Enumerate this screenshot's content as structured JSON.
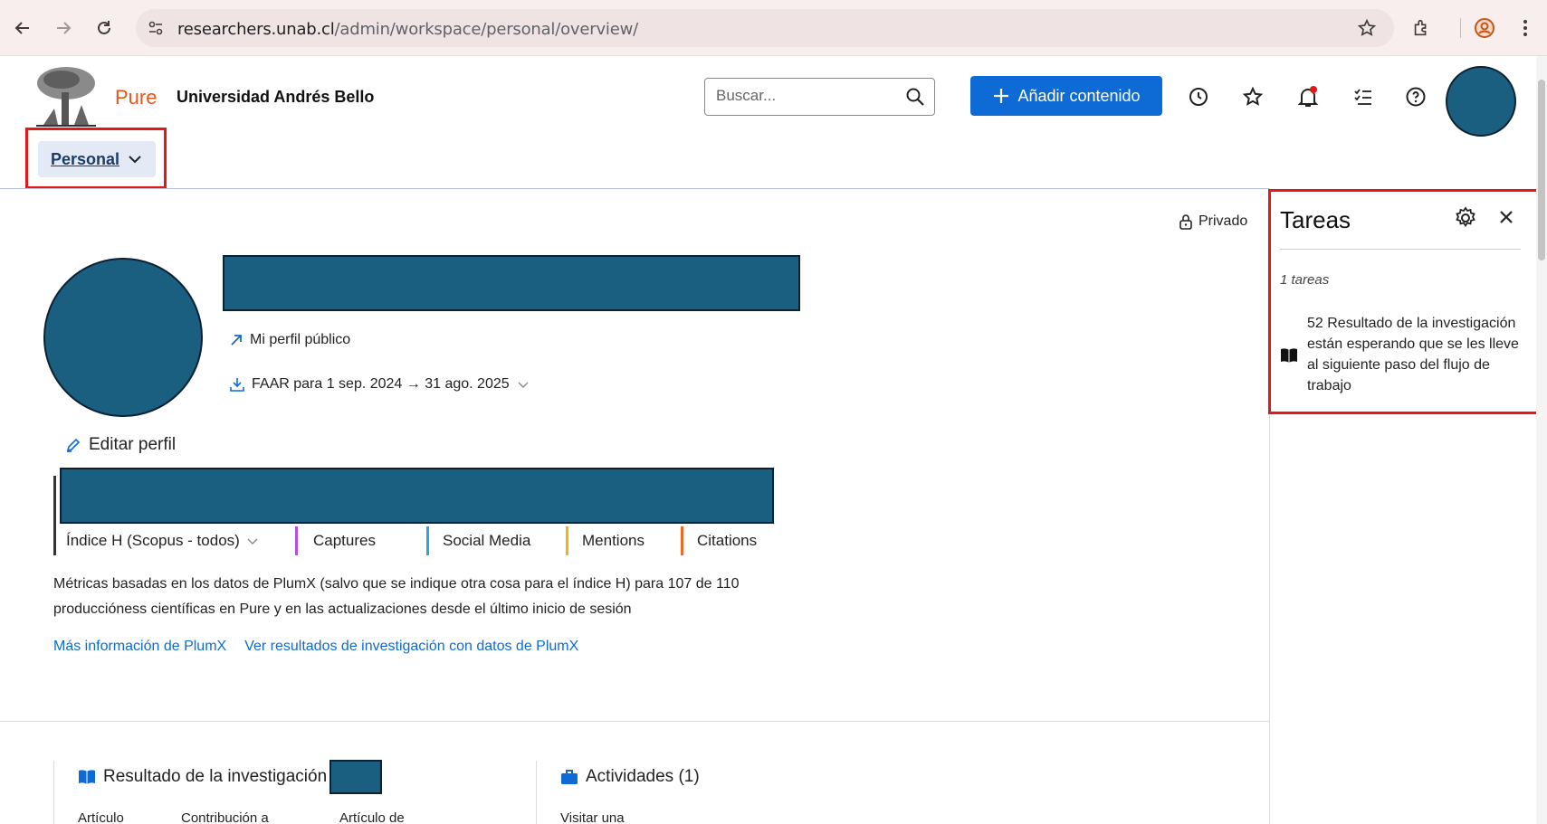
{
  "browser": {
    "url_host": "researchers.unab.cl",
    "url_path": "/admin/workspace/personal/overview/"
  },
  "header": {
    "brand_product": "Pure",
    "brand_org": "Universidad Andrés Bello",
    "search_placeholder": "Buscar...",
    "add_content_label": "Añadir contenido",
    "workspace_tab_label": "Personal"
  },
  "profile": {
    "privacy_label": "Privado",
    "public_profile_link": "Mi perfil público",
    "faar_label": "FAAR para 1 sep. 2024 → 31 ago. 2025",
    "edit_profile_label": "Editar perfil"
  },
  "metrics": {
    "items": [
      {
        "label": "Índice H (Scopus - todos)",
        "color": "#333333"
      },
      {
        "label": "Captures",
        "color": "#b84fe0"
      },
      {
        "label": "Social Media",
        "color": "#2aa7d8"
      },
      {
        "label": "Mentions",
        "color": "#f0b31c"
      },
      {
        "label": "Citations",
        "color": "#ec6a25"
      }
    ],
    "note": "Métricas basadas en los datos de PlumX (salvo que se indique otra cosa para el índice H) para 107 de 110 produccióness científicas en Pure y en las actualizaciones desde el último inicio de sesión",
    "link_more": "Más información de PlumX",
    "link_results": "Ver resultados de investigación con datos de PlumX"
  },
  "sections": {
    "research_title": "Resultado de la investigación",
    "activities_title": "Actividades (1)",
    "research_cols": [
      "Artículo",
      "Contribución a",
      "Artículo de"
    ],
    "activities_cols": [
      "Visitar una"
    ]
  },
  "tasks": {
    "title": "Tareas",
    "count_label": "1 tareas",
    "item_text": "52 Resultado de la investigación están esperando que se les lleve al siguiente paso del flujo de trabajo"
  },
  "colors": {
    "accent": "#0e6bd6",
    "brand": "#e8561b",
    "redaction": "#1a5e80",
    "highlight": "#e11919"
  }
}
